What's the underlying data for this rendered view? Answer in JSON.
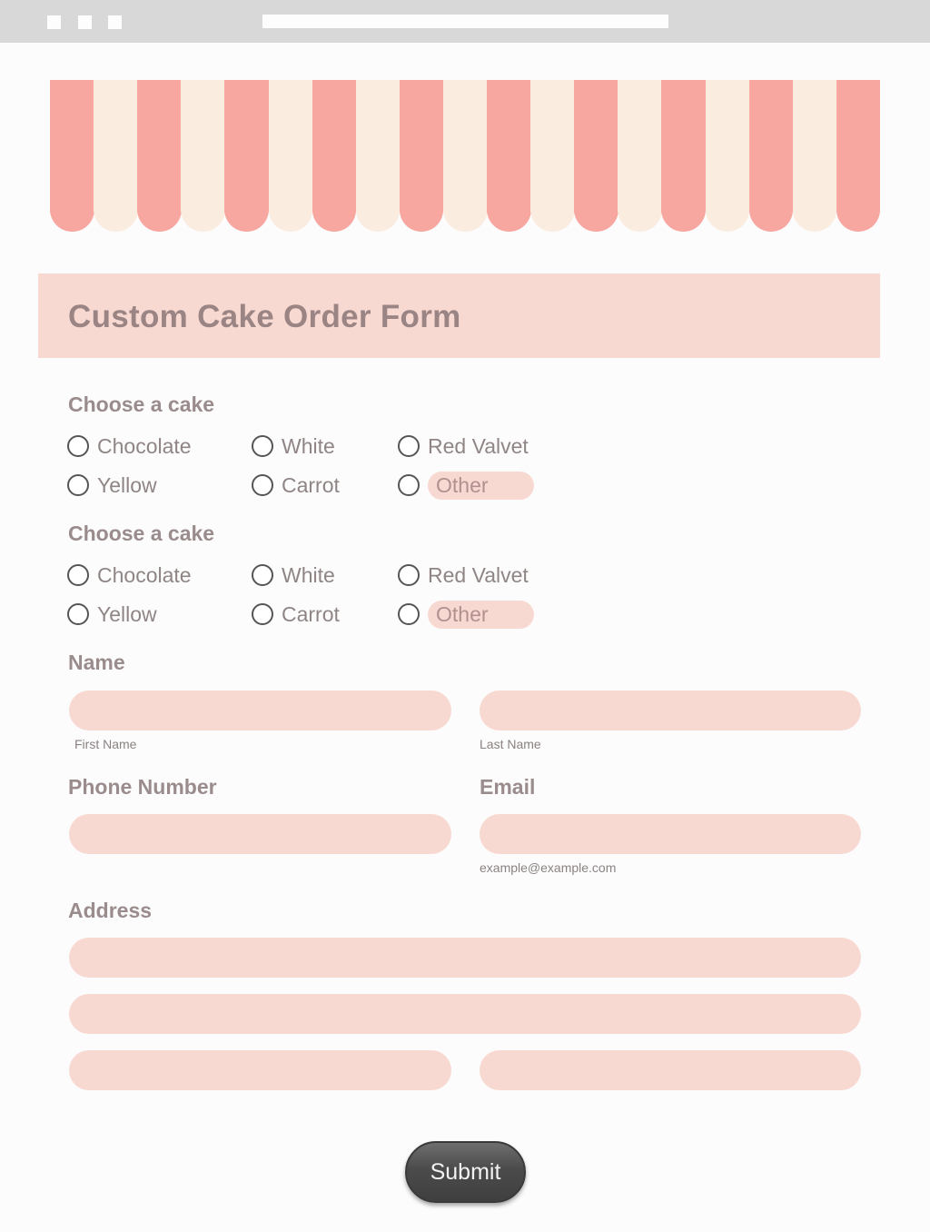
{
  "colors": {
    "awning_pink": "#f7a6a0",
    "awning_cream": "#fbece0",
    "band": "#f8d9d2",
    "field": "#f8d9d2",
    "button": "#4b4b4b"
  },
  "form": {
    "title": "Custom Cake Order Form",
    "cake_group_1": {
      "label": "Choose a cake",
      "options": [
        "Chocolate",
        "White",
        "Red Valvet",
        "Yellow",
        "Carrot",
        "Other"
      ]
    },
    "cake_group_2": {
      "label": "Choose a cake",
      "options": [
        "Chocolate",
        "White",
        "Red Valvet",
        "Yellow",
        "Carrot",
        "Other"
      ]
    },
    "name": {
      "label": "Name",
      "first_sublabel": "First Name",
      "last_sublabel": "Last Name"
    },
    "phone": {
      "label": "Phone Number"
    },
    "email": {
      "label": "Email",
      "sublabel": "example@example.com"
    },
    "address": {
      "label": "Address"
    },
    "submit_label": "Submit"
  }
}
